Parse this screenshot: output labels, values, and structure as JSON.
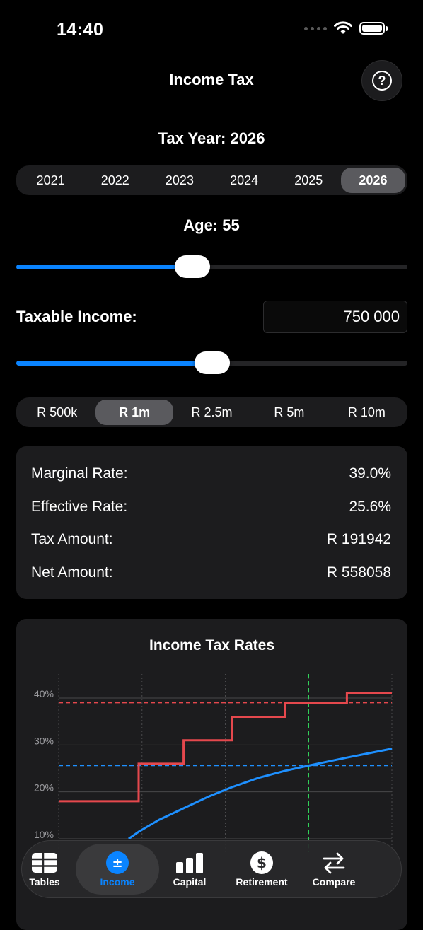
{
  "status_bar": {
    "time": "14:40"
  },
  "nav": {
    "title": "Income Tax",
    "help_glyph": "?"
  },
  "tax_year": {
    "label": "Tax Year: 2026",
    "options": [
      "2021",
      "2022",
      "2023",
      "2024",
      "2025",
      "2026"
    ],
    "selected": "2026"
  },
  "age": {
    "label": "Age: 55",
    "slider_fraction": 0.45
  },
  "income": {
    "label": "Taxable Income:",
    "value": "750 000",
    "slider_fraction": 0.5
  },
  "presets": {
    "options": [
      "R 500k",
      "R 1m",
      "R 2.5m",
      "R 5m",
      "R 10m"
    ],
    "selected": "R 1m"
  },
  "results": {
    "rows": [
      {
        "label": "Marginal Rate:",
        "value": "39.0%"
      },
      {
        "label": "Effective Rate:",
        "value": "25.6%"
      },
      {
        "label": "Tax Amount:",
        "value": "R 191942"
      },
      {
        "label": "Net Amount:",
        "value": "R 558058"
      }
    ]
  },
  "chart_data": {
    "type": "line",
    "title": "Income Tax Rates",
    "y_ticks": [
      "40%",
      "30%",
      "20%",
      "10%"
    ],
    "ylim": [
      10,
      45
    ],
    "xlim": [
      0,
      1000000
    ],
    "series": [
      {
        "name": "",
        "style": "step",
        "color": "#e5484d",
        "points": [
          [
            0,
            18
          ],
          [
            240000,
            18
          ],
          [
            240000,
            26
          ],
          [
            375000,
            26
          ],
          [
            375000,
            31
          ],
          [
            520000,
            31
          ],
          [
            520000,
            36
          ],
          [
            680000,
            36
          ],
          [
            680000,
            39
          ],
          [
            865000,
            39
          ],
          [
            865000,
            41
          ],
          [
            1000000,
            41
          ]
        ]
      },
      {
        "name": "",
        "style": "curve",
        "color": "#1e90ff",
        "points": [
          [
            210000,
            10
          ],
          [
            240000,
            11.5
          ],
          [
            300000,
            14
          ],
          [
            375000,
            16.5
          ],
          [
            450000,
            19
          ],
          [
            520000,
            21
          ],
          [
            600000,
            23
          ],
          [
            680000,
            24.5
          ],
          [
            750000,
            25.6
          ],
          [
            865000,
            27.3
          ],
          [
            1000000,
            29.2
          ]
        ]
      }
    ],
    "reference_lines": [
      {
        "axis": "y",
        "value": 39,
        "color": "#e5484d"
      },
      {
        "axis": "y",
        "value": 25.6,
        "color": "#1e90ff"
      },
      {
        "axis": "x",
        "value": 750000,
        "color": "#30d158"
      }
    ]
  },
  "tabs": [
    {
      "label": "Tables",
      "icon": "table-icon",
      "selected": false
    },
    {
      "label": "Income",
      "icon": "plus-minus-icon",
      "selected": true
    },
    {
      "label": "Capital",
      "icon": "bar-chart-icon",
      "selected": false
    },
    {
      "label": "Retirement",
      "icon": "dollar-circle-icon",
      "selected": false
    },
    {
      "label": "Compare",
      "icon": "arrows-swap-icon",
      "selected": false
    }
  ],
  "colors": {
    "accent": "#0a84ff",
    "card": "#1c1c1e",
    "background": "#000000"
  }
}
